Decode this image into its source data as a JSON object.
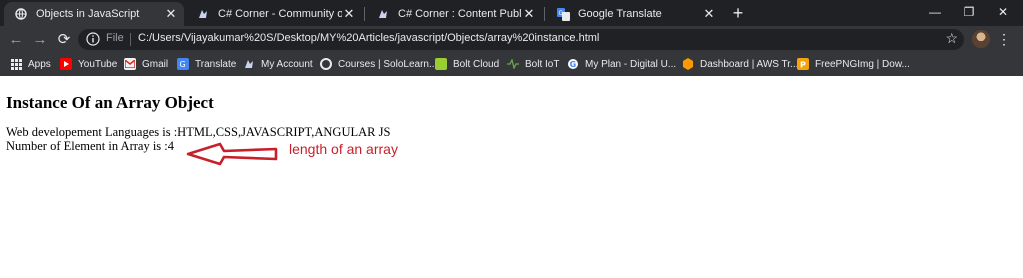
{
  "browser": {
    "tabs": [
      {
        "title": "Objects in JavaScript",
        "icon": "globe-icon",
        "active": true
      },
      {
        "title": "C# Corner - Community of Softw",
        "icon": "csharp-corner-icon",
        "active": false
      },
      {
        "title": "C# Corner : Content Publisher",
        "icon": "csharp-corner-icon",
        "active": false
      },
      {
        "title": "Google Translate",
        "icon": "google-translate-icon",
        "active": false
      }
    ],
    "new_tab_label": "+",
    "window_controls": {
      "minimize": "—",
      "restore": "❐",
      "close": "✕"
    },
    "tab_close": "✕",
    "nav": {
      "back": "←",
      "forward": "→",
      "reload": "⟳"
    },
    "address": {
      "scheme_label": "File",
      "url": "C:/Users/Vijayakumar%20S/Desktop/MY%20Articles/javascript/Objects/array%20instance.html",
      "star": "☆"
    },
    "menu_label": "⋮",
    "bookmarks": [
      {
        "label": "Apps",
        "icon": "apps-grid-icon"
      },
      {
        "label": "YouTube",
        "icon": "youtube-icon"
      },
      {
        "label": "Gmail",
        "icon": "gmail-icon"
      },
      {
        "label": "Translate",
        "icon": "google-translate-icon"
      },
      {
        "label": "My Account",
        "icon": "c-sharp-corner-icon"
      },
      {
        "label": "Courses | SoloLearn...",
        "icon": "sololearn-icon"
      },
      {
        "label": "Bolt Cloud",
        "icon": "bolt-cloud-icon"
      },
      {
        "label": "Bolt IoT",
        "icon": "bolt-iot-icon"
      },
      {
        "label": "My Plan - Digital U...",
        "icon": "google-icon"
      },
      {
        "label": "Dashboard | AWS Tr...",
        "icon": "aws-icon"
      },
      {
        "label": "FreePNGImg | Dow...",
        "icon": "freepngimg-icon"
      }
    ]
  },
  "page": {
    "heading": "Instance Of an Array Object",
    "line1": "Web developement Languages is :HTML,CSS,JAVASCRIPT,ANGULAR JS",
    "line2": "Number of Element in Array is :4",
    "annotation": "length of an array"
  },
  "colors": {
    "annotation": "#c8202b",
    "chrome_dark": "#202124",
    "chrome_tab": "#35363a"
  }
}
